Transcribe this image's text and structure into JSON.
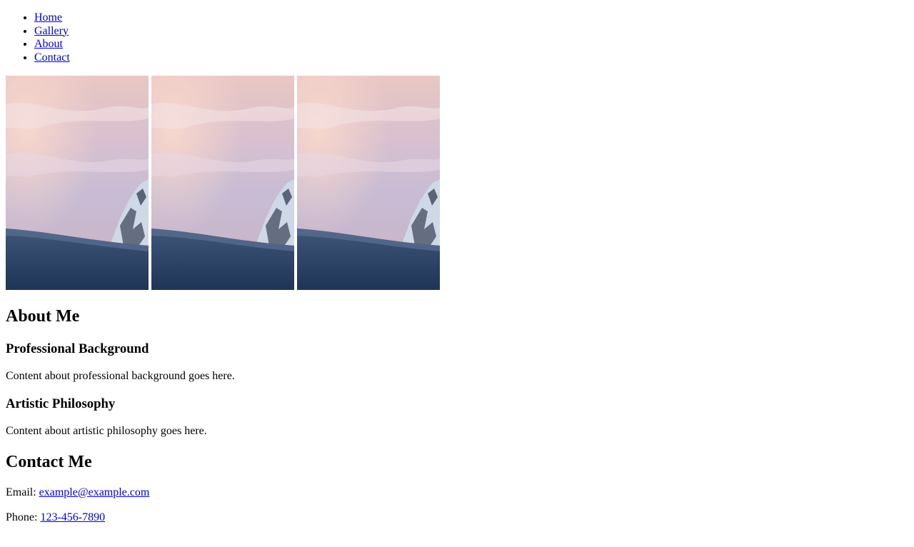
{
  "nav": {
    "items": [
      {
        "label": "Home"
      },
      {
        "label": "Gallery"
      },
      {
        "label": "About"
      },
      {
        "label": "Contact"
      }
    ]
  },
  "gallery": {
    "images": [
      {
        "subject": "snowy-mountain-sunset"
      },
      {
        "subject": "snowy-mountain-sunset"
      },
      {
        "subject": "snowy-mountain-sunset"
      }
    ]
  },
  "about": {
    "title": "About Me",
    "professional": {
      "heading": "Professional Background",
      "text": "Content about professional background goes here."
    },
    "artistic": {
      "heading": "Artistic Philosophy",
      "text": "Content about artistic philosophy goes here."
    }
  },
  "contact": {
    "title": "Contact Me",
    "email_label": "Email: ",
    "email": "example@example.com",
    "phone_label": "Phone: ",
    "phone": "123-456-7890"
  },
  "colors": {
    "link": "#0000ee",
    "text": "#000000",
    "background": "#ffffff"
  }
}
